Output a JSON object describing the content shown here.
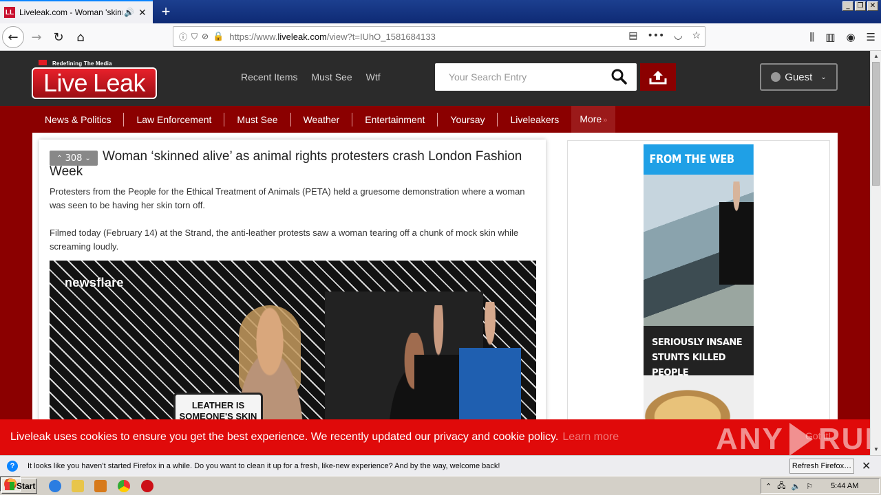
{
  "browser": {
    "tab_title": "Liveleak.com - Woman 'skinned alive'",
    "favicon_text": "LL",
    "url_host": "https://www.liveleak.com",
    "url_domain": "liveleak.com",
    "url_path": "/view?t=IUhO_1581684133"
  },
  "site": {
    "logo_tagline": "Redefining The Media",
    "logo_live": "Live",
    "logo_leak": "Leak",
    "nav": [
      "Recent Items",
      "Must See",
      "Wtf"
    ],
    "search_placeholder": "Your Search Entry",
    "guest_label": "Guest",
    "categories": [
      "News & Politics",
      "Law Enforcement",
      "Must See",
      "Weather",
      "Entertainment",
      "Yoursay",
      "Liveleakers"
    ],
    "more_label": "More",
    "accent_color": "#8b0000"
  },
  "article": {
    "votes": "308",
    "headline": "Woman ‘skinned alive’ as animal rights protesters crash London Fashion Week",
    "para1": "Protesters from the People for the Ethical Treatment of Animals (PETA) held a gruesome demonstration where a woman was seen to be having her skin torn off.",
    "para2": "Filmed today (February 14) at the Strand, the anti-leather protests saw a woman tearing off a chunk of mock skin while screaming loudly.",
    "video_watermark": "newsflare",
    "placard_text": "LEATHER IS SOMEONE'S SKIN"
  },
  "ad": {
    "header": "FROM THE WEB",
    "caption": "SERIOUSLY INSANE STUNTS KILLED PEOPLE"
  },
  "cookie": {
    "message": "Liveleak uses cookies to ensure you get the best experience. We recently updated our privacy and cookie policy.",
    "learn_more": "Learn more",
    "got_it": "Got it!"
  },
  "watermark": {
    "left": "ANY",
    "right": "RUN"
  },
  "notification": {
    "text": "It looks like you haven’t started Firefox in a while. Do you want to clean it up for a fresh, like-new experience? And by the way, welcome back!",
    "button": "Refresh Firefox…"
  },
  "taskbar": {
    "start": "Start",
    "time": "5:44 AM"
  }
}
